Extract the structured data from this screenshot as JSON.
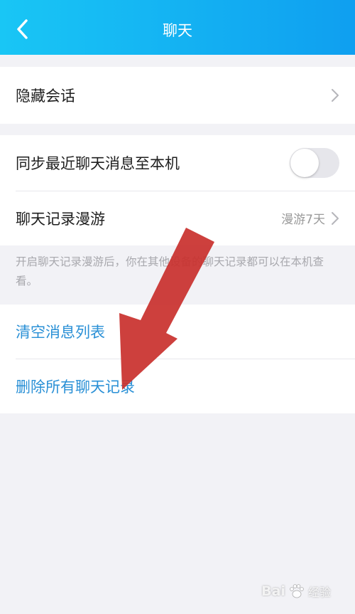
{
  "header": {
    "title": "聊天",
    "back_icon": "chevron-left-icon",
    "gradient_from": "#19c6f5",
    "gradient_to": "#0f9ff0"
  },
  "section1": {
    "hide_chat_label": "隐藏会话"
  },
  "section2": {
    "sync_label": "同步最近聊天消息至本机",
    "sync_enabled": false,
    "roaming_label": "聊天记录漫游",
    "roaming_value": "漫游7天"
  },
  "description": "开启聊天记录漫游后，你在其他设备的聊天记录都可以在本机查看。",
  "section3": {
    "clear_list_label": "清空消息列表",
    "delete_all_label": "删除所有聊天记录",
    "action_color": "#2a90d6"
  },
  "watermark": {
    "brand": "Bai",
    "icon": "paw-icon",
    "text": "经验"
  },
  "annotation": {
    "arrow_color": "#c9302c"
  }
}
